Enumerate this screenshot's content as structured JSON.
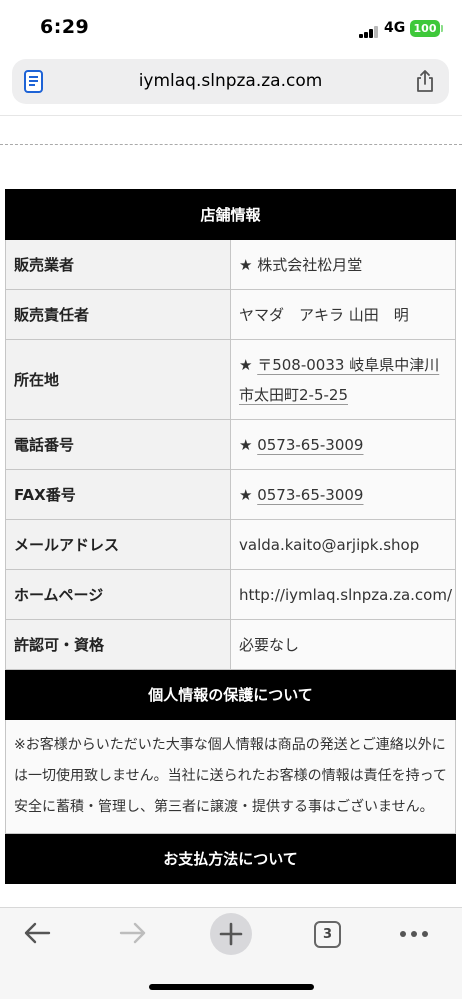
{
  "status": {
    "time": "6:29",
    "network": "4G",
    "battery": "100"
  },
  "browser": {
    "url": "iymlaq.slnpza.za.com",
    "tab_count": "3"
  },
  "shop_info": {
    "header": "店舗情報",
    "rows": [
      {
        "label": "販売業者",
        "value": "★ 株式会社松月堂"
      },
      {
        "label": "販売責任者",
        "value": "ヤマダ　アキラ 山田　明"
      },
      {
        "label": "所在地",
        "star": "★ ",
        "value": "〒508-0033 岐阜県中津川市太田町2-5-25"
      },
      {
        "label": "電話番号",
        "star": "★ ",
        "value": "0573-65-3009"
      },
      {
        "label": "FAX番号",
        "star": "★ ",
        "value": "0573-65-3009"
      },
      {
        "label": "メールアドレス",
        "value": "valda.kaito@arjipk.shop"
      },
      {
        "label": "ホームページ",
        "value": "http://iymlaq.slnpza.za.com/"
      },
      {
        "label": "許認可・資格",
        "value": "必要なし"
      }
    ]
  },
  "privacy": {
    "header": "個人情報の保護について",
    "text": "※お客様からいただいた大事な個人情報は商品の発送とご連絡以外には一切使用致しません。当社に送られたお客様の情報は責任を持って安全に蓄積・管理し、第三者に譲渡・提供する事はございません。"
  },
  "payment": {
    "header": "お支払方法について"
  },
  "colors": {
    "link": "#e03a1e",
    "header_bg": "#000000",
    "battery": "#3ec83a",
    "accent": "#1e63d6"
  }
}
